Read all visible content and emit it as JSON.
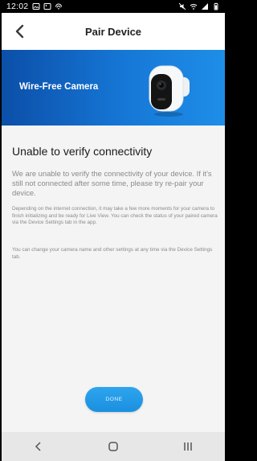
{
  "status_bar": {
    "time": "12:02",
    "left_icons": [
      "gallery-icon",
      "image-icon",
      "link-icon"
    ],
    "right_icons": [
      "mute-icon",
      "wifi-icon",
      "signal-icon",
      "battery-icon"
    ]
  },
  "header": {
    "title": "Pair Device",
    "back_icon": "chevron-left-icon"
  },
  "banner": {
    "label": "Wire-Free Camera",
    "image": "camera-icon",
    "gradient_start": "#0b4fa8",
    "gradient_end": "#1e8ee8"
  },
  "main": {
    "heading": "Unable to verify connectivity",
    "lead": "We are unable to verify the connectivity of your device. If it's still not connected after some time, please try re-pair your device.",
    "detail": "Depending on the internet connection, it may take a few more moments for your camera to finish initializing and be ready for Live View. You can check the status of your paired camera via the Device Settings tab in the app.",
    "detail2": "You can change your camera name and other settings at any time via the Device Settings tab."
  },
  "footer": {
    "done_label": "DONE",
    "accent": "#1b8fe0"
  },
  "nav_bar": {
    "icons": [
      "back-nav-icon",
      "home-nav-icon",
      "recents-nav-icon"
    ]
  }
}
